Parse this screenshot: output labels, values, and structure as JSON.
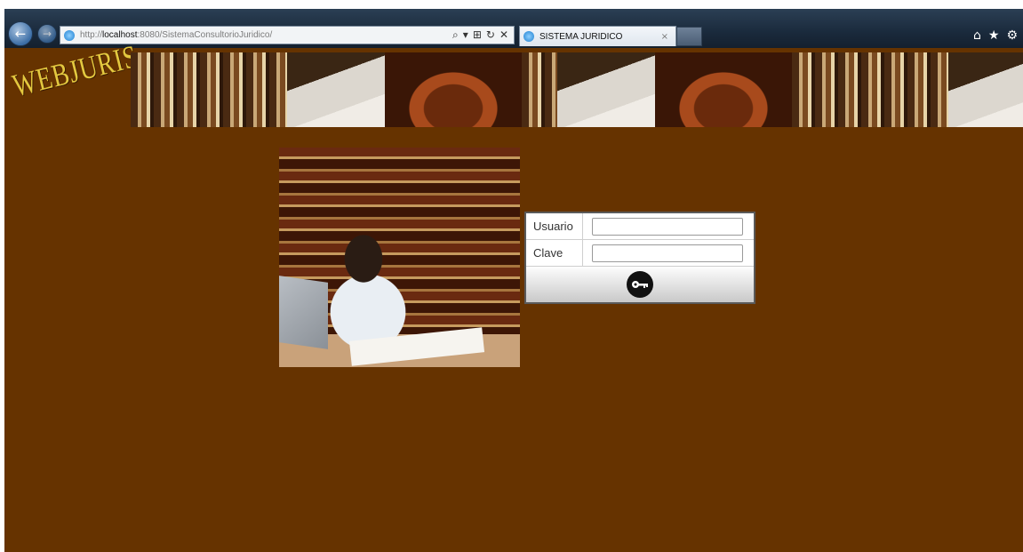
{
  "browser": {
    "window_buttons": [
      "—",
      "□",
      "x"
    ],
    "address": {
      "prefix": "http://",
      "host": "localhost",
      "path": ":8080/SistemaConsultorioJuridico/",
      "tools": [
        "⌕",
        "▾",
        "⊞",
        "↻",
        "✕"
      ]
    },
    "tab": {
      "title": "SISTEMA JURIDICO",
      "close": "×"
    },
    "toolbar_icons": [
      "home-icon",
      "favorites-star-icon",
      "settings-gear-icon"
    ]
  },
  "header": {
    "logo": "WEBJURIS",
    "banner_images": [
      "bookshelf",
      "signing-pen",
      "gavel",
      "bookshelf",
      "signing-pen",
      "gavel",
      "bookshelf",
      "signing-pen"
    ]
  },
  "login": {
    "user_label": "Usuario",
    "user_value": "",
    "password_label": "Clave",
    "password_value": "",
    "submit_icon": "key-icon"
  },
  "colors": {
    "page_background": "#663300",
    "logo": "#e3c83f"
  }
}
